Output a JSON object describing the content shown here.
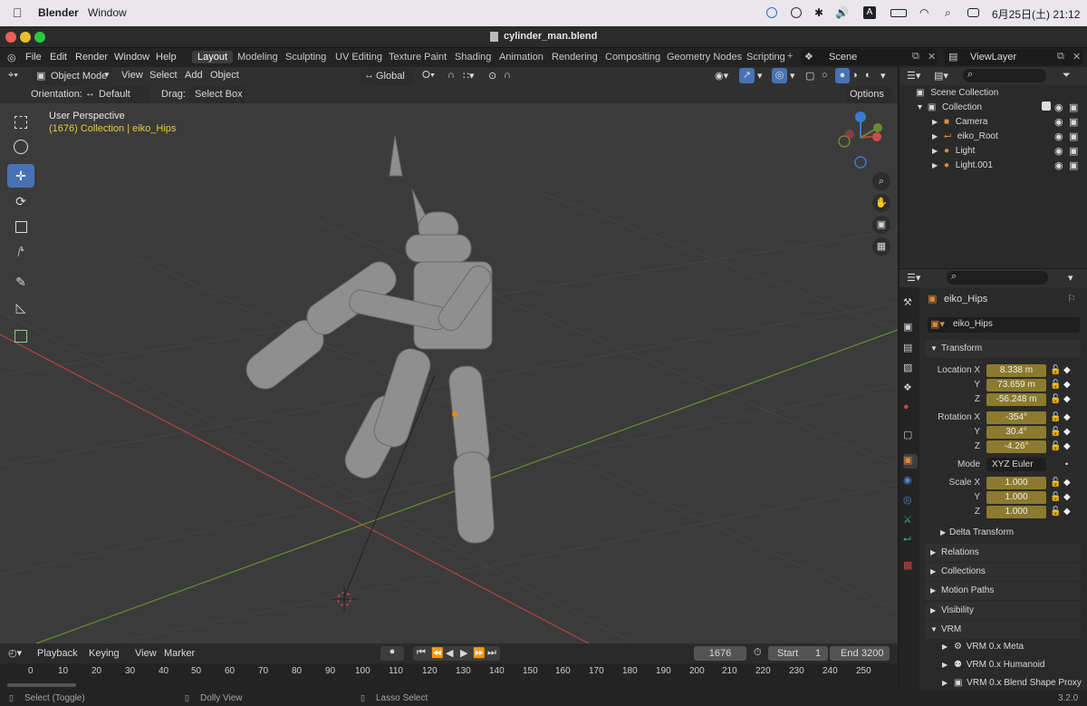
{
  "mac": {
    "app": "Blender",
    "menu": "Window",
    "datetime": "6月25日(土) 21:12",
    "input_mode": "A"
  },
  "window": {
    "title": "cylinder_man.blend"
  },
  "topmenu": [
    "File",
    "Edit",
    "Render",
    "Window",
    "Help"
  ],
  "workspaces": [
    "Layout",
    "Modeling",
    "Sculpting",
    "UV Editing",
    "Texture Paint",
    "Shading",
    "Animation",
    "Rendering",
    "Compositing",
    "Geometry Nodes",
    "Scripting"
  ],
  "scene": {
    "name": "Scene",
    "view_layer": "ViewLayer"
  },
  "viewport_header": {
    "mode": "Object Mode",
    "menus": [
      "View",
      "Select",
      "Add",
      "Object"
    ],
    "transform_orientation": "Global",
    "options": "Options"
  },
  "tool_settings": {
    "orientation_label": "Orientation:",
    "orientation_value": "Default",
    "drag_label": "Drag:",
    "drag_value": "Select Box"
  },
  "viewport_overlay": {
    "perspective": "User Perspective",
    "context": "(1676) Collection | eiko_Hips"
  },
  "outliner": {
    "root": "Scene Collection",
    "collection": "Collection",
    "items": [
      "Camera",
      "eiko_Root",
      "Light",
      "Light.001"
    ]
  },
  "properties": {
    "object_name": "eiko_Hips",
    "data_name": "eiko_Hips",
    "transform_header": "Transform",
    "location_label": "Location X",
    "location": [
      "8.338 m",
      "73.659 m",
      "-56.248 m"
    ],
    "rotation_label": "Rotation X",
    "rotation": [
      "-354°",
      "30.4°",
      "-4.26°"
    ],
    "mode_label": "Mode",
    "mode_value": "XYZ Euler",
    "scale_label": "Scale X",
    "scale": [
      "1.000",
      "1.000",
      "1.000"
    ],
    "axis_y": "Y",
    "axis_z": "Z",
    "collapsed": [
      "Delta Transform",
      "Relations",
      "Collections",
      "Motion Paths",
      "Visibility"
    ],
    "vrm_header": "VRM",
    "vrm_items": [
      "VRM 0.x Meta",
      "VRM 0.x Humanoid",
      "VRM 0.x Blend Shape Proxy"
    ]
  },
  "timeline": {
    "menus": [
      "Playback",
      "Keying",
      "View",
      "Marker"
    ],
    "current_frame": "1676",
    "start_label": "Start",
    "start": "1",
    "end_label": "End",
    "end": "3200",
    "ruler": [
      "0",
      "10",
      "20",
      "30",
      "40",
      "50",
      "60",
      "70",
      "80",
      "90",
      "100",
      "110",
      "120",
      "130",
      "140",
      "150",
      "160",
      "170",
      "180",
      "190",
      "200",
      "210",
      "220",
      "230",
      "240",
      "250"
    ]
  },
  "status": {
    "left": "Select (Toggle)",
    "middle": "Dolly View",
    "right": "Lasso Select",
    "version": "3.2.0"
  },
  "colors": {
    "accent": "#4772b3",
    "field": "#8c7a2f",
    "x_axis": "#b54444",
    "y_axis": "#6c8a2f",
    "z_axis": "#3a7ad0"
  }
}
